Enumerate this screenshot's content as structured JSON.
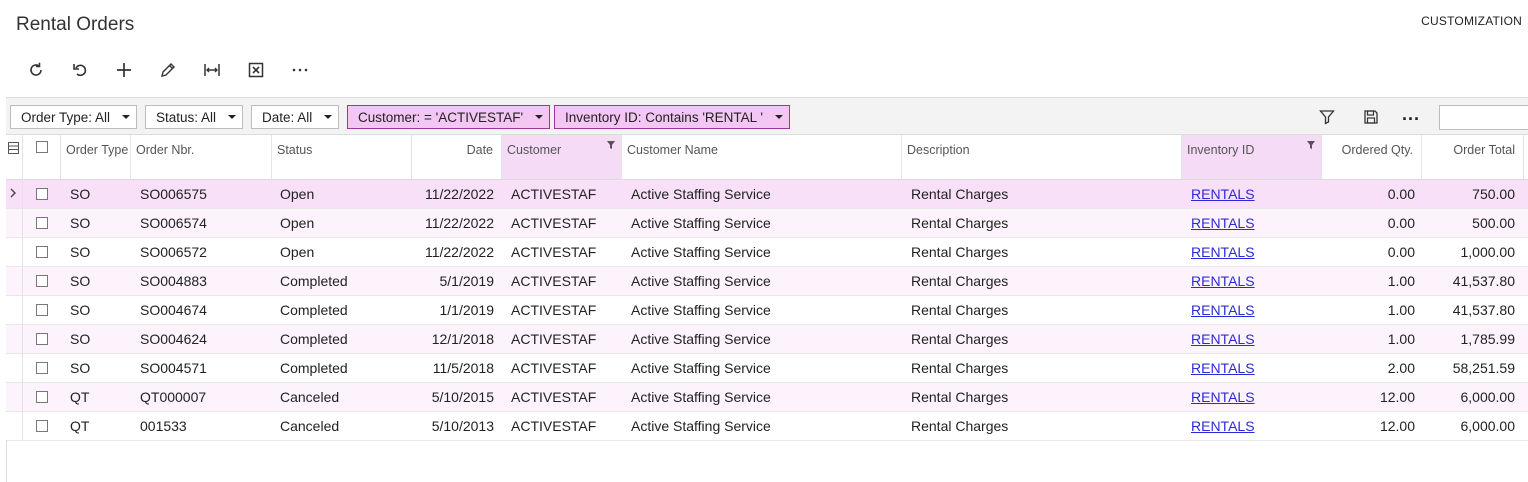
{
  "page": {
    "title": "Rental Orders",
    "customization_label": "CUSTOMIZATION"
  },
  "toolbar": {
    "buttons": [
      {
        "name": "refresh-button",
        "icon": "refresh-icon"
      },
      {
        "name": "undo-button",
        "icon": "undo-icon"
      },
      {
        "name": "add-button",
        "icon": "plus-icon"
      },
      {
        "name": "edit-button",
        "icon": "pencil-icon"
      },
      {
        "name": "fit-columns-button",
        "icon": "fit-width-icon"
      },
      {
        "name": "export-excel-button",
        "icon": "excel-icon"
      },
      {
        "name": "more-actions-button",
        "icon": "ellipsis-icon"
      }
    ]
  },
  "filters": {
    "chips": [
      {
        "label": "Order Type: All",
        "active": false
      },
      {
        "label": "Status: All",
        "active": false
      },
      {
        "label": "Date: All",
        "active": false
      },
      {
        "label": "Customer: = 'ACTIVESTAF'",
        "active": true
      },
      {
        "label": "Inventory ID: Contains 'RENTAL '",
        "active": true
      }
    ],
    "search_value": "",
    "more_label": "..."
  },
  "grid": {
    "columns": [
      {
        "key": "order_type",
        "label": "Order Type"
      },
      {
        "key": "order_nbr",
        "label": "Order Nbr."
      },
      {
        "key": "status",
        "label": "Status"
      },
      {
        "key": "date",
        "label": "Date"
      },
      {
        "key": "customer",
        "label": "Customer",
        "filtered": true
      },
      {
        "key": "customer_name",
        "label": "Customer Name"
      },
      {
        "key": "description",
        "label": "Description"
      },
      {
        "key": "inventory_id",
        "label": "Inventory ID",
        "filtered": true
      },
      {
        "key": "ordered_qty",
        "label": "Ordered Qty."
      },
      {
        "key": "order_total",
        "label": "Order Total"
      }
    ],
    "rows": [
      {
        "order_type": "SO",
        "order_nbr": "SO006575",
        "status": "Open",
        "date": "11/22/2022",
        "customer": "ACTIVESTAF",
        "customer_name": "Active Staffing Service",
        "description": "Rental Charges",
        "inventory_id": "RENTALS",
        "ordered_qty": "0.00",
        "order_total": "750.00",
        "selected": true
      },
      {
        "order_type": "SO",
        "order_nbr": "SO006574",
        "status": "Open",
        "date": "11/22/2022",
        "customer": "ACTIVESTAF",
        "customer_name": "Active Staffing Service",
        "description": "Rental Charges",
        "inventory_id": "RENTALS",
        "ordered_qty": "0.00",
        "order_total": "500.00"
      },
      {
        "order_type": "SO",
        "order_nbr": "SO006572",
        "status": "Open",
        "date": "11/22/2022",
        "customer": "ACTIVESTAF",
        "customer_name": "Active Staffing Service",
        "description": "Rental Charges",
        "inventory_id": "RENTALS",
        "ordered_qty": "0.00",
        "order_total": "1,000.00"
      },
      {
        "order_type": "SO",
        "order_nbr": "SO004883",
        "status": "Completed",
        "date": "5/1/2019",
        "customer": "ACTIVESTAF",
        "customer_name": "Active Staffing Service",
        "description": "Rental Charges",
        "inventory_id": "RENTALS",
        "ordered_qty": "1.00",
        "order_total": "41,537.80"
      },
      {
        "order_type": "SO",
        "order_nbr": "SO004674",
        "status": "Completed",
        "date": "1/1/2019",
        "customer": "ACTIVESTAF",
        "customer_name": "Active Staffing Service",
        "description": "Rental Charges",
        "inventory_id": "RENTALS",
        "ordered_qty": "1.00",
        "order_total": "41,537.80"
      },
      {
        "order_type": "SO",
        "order_nbr": "SO004624",
        "status": "Completed",
        "date": "12/1/2018",
        "customer": "ACTIVESTAF",
        "customer_name": "Active Staffing Service",
        "description": "Rental Charges",
        "inventory_id": "RENTALS",
        "ordered_qty": "1.00",
        "order_total": "1,785.99"
      },
      {
        "order_type": "SO",
        "order_nbr": "SO004571",
        "status": "Completed",
        "date": "11/5/2018",
        "customer": "ACTIVESTAF",
        "customer_name": "Active Staffing Service",
        "description": "Rental Charges",
        "inventory_id": "RENTALS",
        "ordered_qty": "2.00",
        "order_total": "58,251.59"
      },
      {
        "order_type": "QT",
        "order_nbr": "QT000007",
        "status": "Canceled",
        "date": "5/10/2015",
        "customer": "ACTIVESTAF",
        "customer_name": "Active Staffing Service",
        "description": "Rental Charges",
        "inventory_id": "RENTALS",
        "ordered_qty": "12.00",
        "order_total": "6,000.00"
      },
      {
        "order_type": "QT",
        "order_nbr": "001533",
        "status": "Canceled",
        "date": "5/10/2013",
        "customer": "ACTIVESTAF",
        "customer_name": "Active Staffing Service",
        "description": "Rental Charges",
        "inventory_id": "RENTALS",
        "ordered_qty": "12.00",
        "order_total": "6,000.00"
      }
    ]
  }
}
